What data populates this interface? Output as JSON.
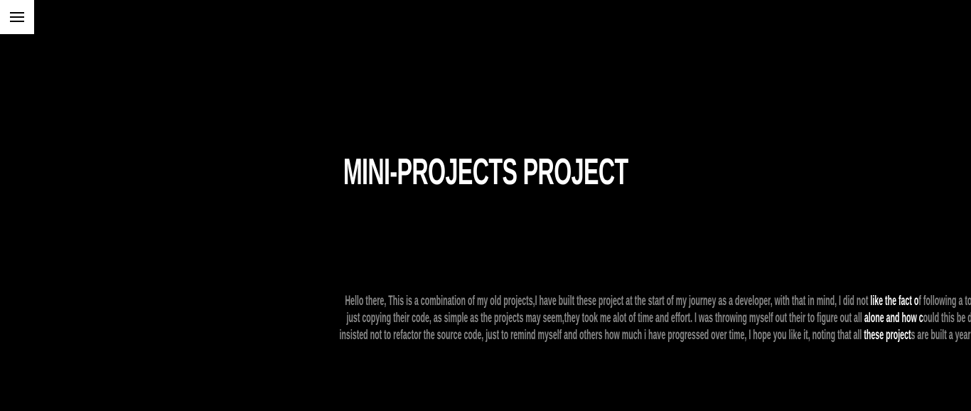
{
  "menu": {
    "icon": "hamburger-icon"
  },
  "header": {
    "title": "MINI-PROJECTS PROJECT"
  },
  "intro": {
    "line1_a": "Hello there, This is a combination of my old projects,I have built these project at the start of my journey as a developer, with that in mind, I did not ",
    "line1_b": "like the fact o",
    "line1_c": "f following a toturial and",
    "line2_a": "just copying their code, as simple as the projects may seem,they took me alot of time and effort. I was throwing myself out their to figure out all ",
    "line2_b": "alone and how c",
    "line2_c": "ould this be done, I have",
    "line3_a": "insisted not to refactor the source code, just to remind myself and others how much i have progressed over time, I hope you like it, noting that all ",
    "line3_b": "these project",
    "line3_c": "s are built a year ago"
  },
  "colors": {
    "background": "#000000",
    "title": "#ffffff",
    "text_dim": "#8a8a8a",
    "text_highlight": "#ffffff"
  }
}
